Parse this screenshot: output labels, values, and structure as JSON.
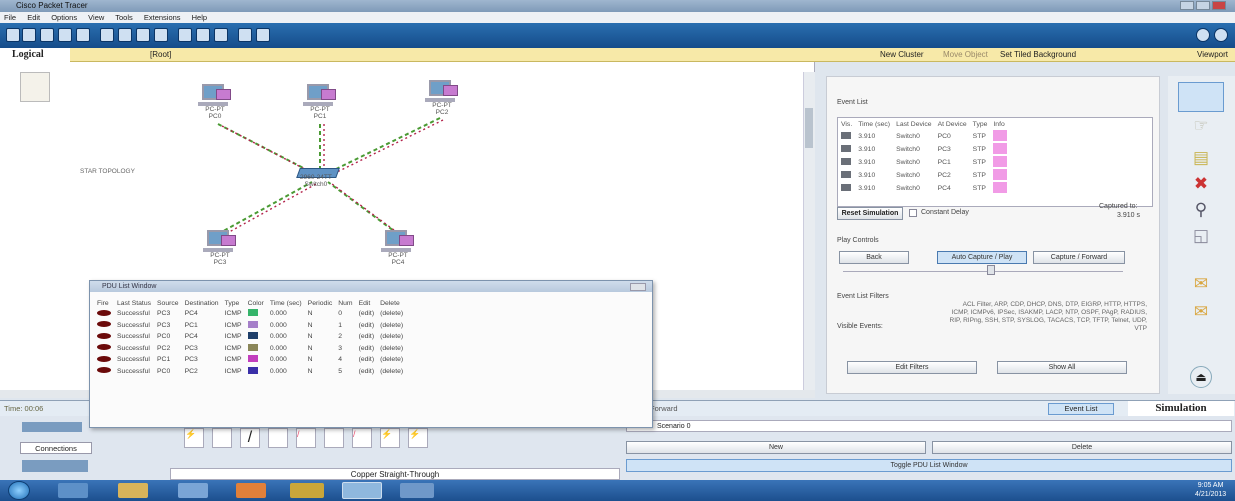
{
  "window": {
    "title": "Cisco Packet Tracer"
  },
  "menu": [
    "File",
    "Edit",
    "Options",
    "View",
    "Tools",
    "Extensions",
    "Help"
  ],
  "workspace_bar": {
    "mode": "Logical",
    "root": "[Root]",
    "new_cluster": "New Cluster",
    "move_object": "Move Object",
    "set_tiled": "Set Tiled Background",
    "viewport": "Viewport"
  },
  "topology": {
    "label": "STAR TOPOLOGY",
    "switch": {
      "type": "2960-24TT",
      "name": "Switch0"
    },
    "pcs": [
      {
        "type": "PC-PT",
        "name": "PC0"
      },
      {
        "type": "PC-PT",
        "name": "PC1"
      },
      {
        "type": "PC-PT",
        "name": "PC2"
      },
      {
        "type": "PC-PT",
        "name": "PC3"
      },
      {
        "type": "PC-PT",
        "name": "PC4"
      }
    ]
  },
  "pdu_window": {
    "title": "PDU List Window",
    "columns": [
      "Fire",
      "Last Status",
      "Source",
      "Destination",
      "Type",
      "Color",
      "Time (sec)",
      "Periodic",
      "Num",
      "Edit",
      "Delete"
    ],
    "rows": [
      {
        "status": "Successful",
        "src": "PC3",
        "dst": "PC4",
        "type": "ICMP",
        "color": "#35b46a",
        "time": "0.000",
        "periodic": "N",
        "num": "0",
        "edit": "(edit)",
        "del": "(delete)"
      },
      {
        "status": "Successful",
        "src": "PC3",
        "dst": "PC1",
        "type": "ICMP",
        "color": "#a57fc9",
        "time": "0.000",
        "periodic": "N",
        "num": "1",
        "edit": "(edit)",
        "del": "(delete)"
      },
      {
        "status": "Successful",
        "src": "PC0",
        "dst": "PC4",
        "type": "ICMP",
        "color": "#1f3f6a",
        "time": "0.000",
        "periodic": "N",
        "num": "2",
        "edit": "(edit)",
        "del": "(delete)"
      },
      {
        "status": "Successful",
        "src": "PC2",
        "dst": "PC3",
        "type": "ICMP",
        "color": "#8a8659",
        "time": "0.000",
        "periodic": "N",
        "num": "3",
        "edit": "(edit)",
        "del": "(delete)"
      },
      {
        "status": "Successful",
        "src": "PC1",
        "dst": "PC3",
        "type": "ICMP",
        "color": "#c23fbd",
        "time": "0.000",
        "periodic": "N",
        "num": "4",
        "edit": "(edit)",
        "del": "(delete)"
      },
      {
        "status": "Successful",
        "src": "PC0",
        "dst": "PC2",
        "type": "ICMP",
        "color": "#3a2fa8",
        "time": "0.000",
        "periodic": "N",
        "num": "5",
        "edit": "(edit)",
        "del": "(delete)"
      }
    ]
  },
  "event_list": {
    "title": "Event List",
    "columns": [
      "Vis.",
      "Time (sec)",
      "Last Device",
      "At Device",
      "Type",
      "Info"
    ],
    "rows": [
      {
        "time": "3.910",
        "last": "Switch0",
        "at": "PC0",
        "type": "STP"
      },
      {
        "time": "3.910",
        "last": "Switch0",
        "at": "PC3",
        "type": "STP"
      },
      {
        "time": "3.910",
        "last": "Switch0",
        "at": "PC1",
        "type": "STP"
      },
      {
        "time": "3.910",
        "last": "Switch0",
        "at": "PC2",
        "type": "STP"
      },
      {
        "time": "3.910",
        "last": "Switch0",
        "at": "PC4",
        "type": "STP"
      }
    ],
    "reset": "Reset Simulation",
    "constant_delay": "Constant Delay",
    "captured_to": "Captured to:",
    "captured_value": "3.910 s"
  },
  "play": {
    "title": "Play Controls",
    "back": "Back",
    "auto": "Auto Capture / Play",
    "forward": "Capture / Forward"
  },
  "filters": {
    "title": "Event List Filters",
    "visible_label": "Visible Events:",
    "visible_text": "ACL Filter, ARP, CDP, DHCP, DNS, DTP, EIGRP, HTTP, HTTPS, ICMP, ICMPv6, IPSec, ISAKMP, LACP, NTP, OSPF, PAgP, RADIUS, RIP, RIPng, SSH, STP, SYSLOG, TACACS, TCP, TFTP, Telnet, UDP, VTP",
    "edit": "Edit Filters",
    "show_all": "Show All"
  },
  "status": {
    "time": "Time: 00:06",
    "realtime": "Realtime",
    "forward": "Forward",
    "event_list_btn": "Event List",
    "simulation": "Simulation"
  },
  "bottom": {
    "connections": "Connections",
    "cable": "Copper Straight-Through",
    "scenario": "Scenario 0",
    "new": "New",
    "delete": "Delete",
    "toggle": "Toggle PDU List Window"
  },
  "taskbar": {
    "time": "9:05 AM",
    "date": "4/21/2013"
  }
}
